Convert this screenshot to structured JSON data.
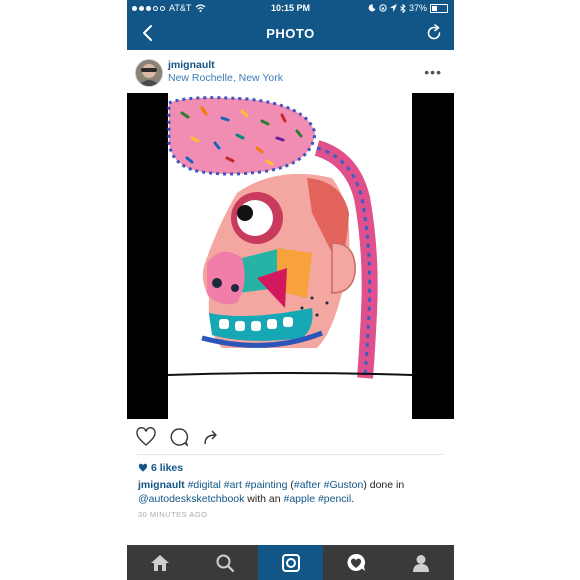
{
  "status_bar": {
    "carrier": "AT&T",
    "time": "10:15 PM",
    "battery": "37%",
    "battery_level": 0.37
  },
  "nav": {
    "title": "PHOTO",
    "icons": [
      "chevron-left-icon",
      "refresh-icon"
    ]
  },
  "post": {
    "username": "jmignault",
    "location": "New Rochelle, New York",
    "more": "•••",
    "likes": "6 likes",
    "caption": {
      "username": "jmignault",
      "segments": [
        {
          "t": " ",
          "tag": false
        },
        {
          "t": "#digital",
          "tag": true
        },
        {
          "t": " ",
          "tag": false
        },
        {
          "t": "#art",
          "tag": true
        },
        {
          "t": " ",
          "tag": false
        },
        {
          "t": "#painting",
          "tag": true
        },
        {
          "t": " (",
          "tag": false
        },
        {
          "t": "#after",
          "tag": true
        },
        {
          "t": " ",
          "tag": false
        },
        {
          "t": "#Guston",
          "tag": true
        },
        {
          "t": ") done in ",
          "tag": false
        },
        {
          "t": "@autodesksketchbook",
          "tag": true
        },
        {
          "t": " with an ",
          "tag": false
        },
        {
          "t": "#apple",
          "tag": true
        },
        {
          "t": " ",
          "tag": false
        },
        {
          "t": "#pencil",
          "tag": true
        },
        {
          "t": ".",
          "tag": false
        }
      ]
    },
    "timestamp": "30 MINUTES AGO"
  },
  "actions": [
    "heart-icon",
    "comment-icon",
    "share-icon"
  ],
  "tabbar": {
    "items": [
      "home-icon",
      "search-icon",
      "camera-icon",
      "activity-icon",
      "profile-icon"
    ],
    "active_index": 2
  },
  "colors": {
    "brand": "#125688",
    "tabbar": "#3a3a3a",
    "link": "#3b7bb8"
  }
}
